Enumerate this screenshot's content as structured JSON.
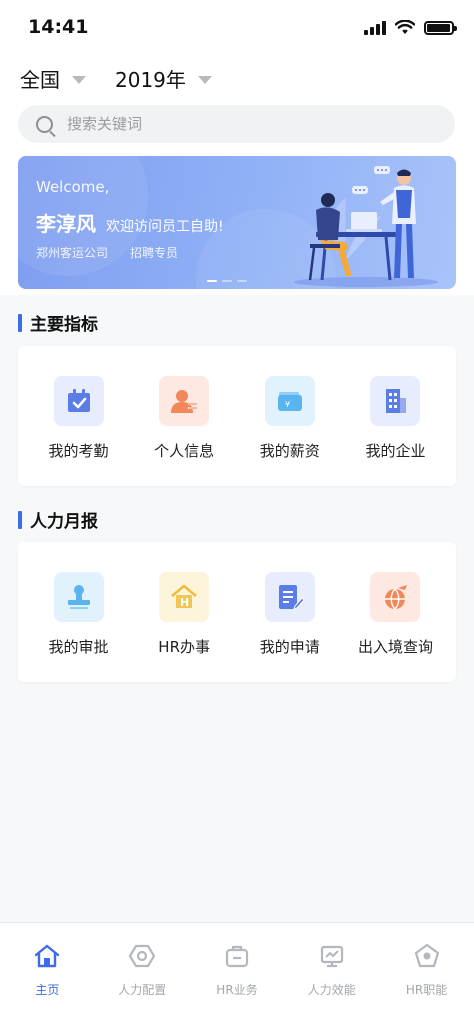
{
  "status_bar": {
    "time": "14:41"
  },
  "filters": {
    "region": "全国",
    "year": "2019年"
  },
  "search": {
    "placeholder": "搜索关键词"
  },
  "banner": {
    "welcome": "Welcome,",
    "name": "李淳风",
    "greeting": "欢迎访问员工自助!",
    "company": "郑州客运公司",
    "role": "招聘专员",
    "slide_count": 3,
    "active_slide": 1
  },
  "sections": {
    "main_indicators": {
      "title": "主要指标",
      "items": [
        {
          "label": "我的考勤",
          "icon": "calendar-check-icon",
          "color": "#5b7de8",
          "bg": "#e7edfc"
        },
        {
          "label": "个人信息",
          "icon": "person-card-icon",
          "color": "#f2875a",
          "bg": "#fde9e1"
        },
        {
          "label": "我的薪资",
          "icon": "wallet-icon",
          "color": "#58b5ef",
          "bg": "#e1f2fc"
        },
        {
          "label": "我的企业",
          "icon": "building-icon",
          "color": "#5b7de8",
          "bg": "#e7edfc"
        }
      ]
    },
    "hr_monthly": {
      "title": "人力月报",
      "items": [
        {
          "label": "我的审批",
          "icon": "stamp-icon",
          "color": "#58b5ef",
          "bg": "#e1f2fc"
        },
        {
          "label": "HR办事",
          "icon": "house-h-icon",
          "color": "#f0bd3c",
          "bg": "#fdf4dc"
        },
        {
          "label": "我的申请",
          "icon": "document-edit-icon",
          "color": "#5b7de8",
          "bg": "#e7edfc"
        },
        {
          "label": "出入境查询",
          "icon": "globe-plane-icon",
          "color": "#f2875a",
          "bg": "#fde9e1"
        }
      ]
    }
  },
  "tabbar": {
    "items": [
      {
        "label": "主页",
        "icon": "home-icon",
        "active": true
      },
      {
        "label": "人力配置",
        "icon": "hexagon-icon",
        "active": false
      },
      {
        "label": "HR业务",
        "icon": "briefcase-icon",
        "active": false
      },
      {
        "label": "人力效能",
        "icon": "chart-monitor-icon",
        "active": false
      },
      {
        "label": "HR职能",
        "icon": "pentagon-icon",
        "active": false
      }
    ]
  },
  "colors": {
    "accent": "#3e6be8",
    "inactive": "#a3a6ad"
  }
}
